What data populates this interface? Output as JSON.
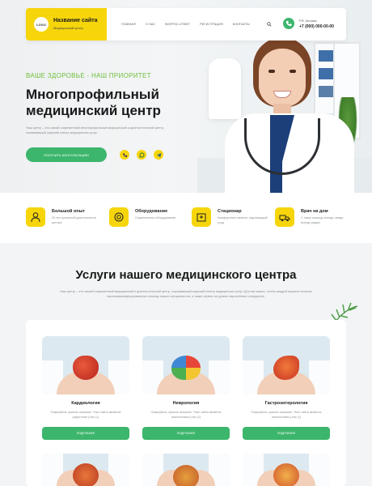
{
  "header": {
    "logo_text": "LOGO",
    "site_title": "Название сайта",
    "site_subtitle": "Медицинский центр",
    "nav": [
      "ГЛАВНАЯ",
      "О НАС",
      "ВОПРОС-ОТВЕТ",
      "РЕГИСТРАЦИЯ",
      "КОНТАКТЫ"
    ],
    "city": "РФ, Москва",
    "phone": "+7 (000) 000-00-00"
  },
  "hero": {
    "tagline": "ВАШЕ ЗДОРОВЬЕ - НАШ ПРИОРИТЕТ",
    "title": "Многопрофильный медицинский центр",
    "text": "Наш центр – это самый современный многопрофильный медицинский и диагностический центр, оказывающий широкий спектр медицинских услуг.",
    "button": "ПОЛУЧИТЬ КОНСУЛЬТАЦИЮ",
    "messengers": [
      "viber-icon",
      "whatsapp-icon",
      "telegram-icon"
    ]
  },
  "features": [
    {
      "icon": "doctor-icon",
      "title": "Большой опыт",
      "desc": "20 лет успешной деятельности центра"
    },
    {
      "icon": "equipment-icon",
      "title": "Оборудование",
      "desc": "Современное оборудование"
    },
    {
      "icon": "hospital-icon",
      "title": "Стационар",
      "desc": "Комфортные палаты, надлежащий уход"
    },
    {
      "icon": "ambulance-icon",
      "title": "Врач на дом",
      "desc": "С нами помощь всегда, везде, всегда рядом"
    }
  ],
  "services": {
    "title": "Услуги нашего медицинского центра",
    "text": "Наш центр – это самый современный медицинский и диагностический центр, оказывающий широкий спектр медицинских услуг. Для вас важно, чтобы каждый пациент получил высококвалифицированную помощь наших специалистов, а также сервис на уровне европейских стандартов.",
    "cards": [
      {
        "name": "Кардиология",
        "desc": "Пожалуйста, краткое описание. Текст сайта является радостным у нас (1)",
        "button": "ПОДРОБНЕЕ",
        "organ_color": "#d7362f"
      },
      {
        "name": "Неврология",
        "desc": "Пожалуйста, краткое описание. Текст сайта является аналогичным у нас (1)",
        "button": "ПОДРОБНЕЕ",
        "organ_color": "#4a8fd0"
      },
      {
        "name": "Гастроэнтерология",
        "desc": "Пожалуйста, краткое описание. Текст сайта является аналогичным у нас (1)",
        "button": "ПОДРОБНЕЕ",
        "organ_color": "#e4492f"
      }
    ]
  },
  "colors": {
    "accent_yellow": "#f6d50b",
    "accent_green": "#3cb66c",
    "tagline_green": "#6fbf3a"
  }
}
